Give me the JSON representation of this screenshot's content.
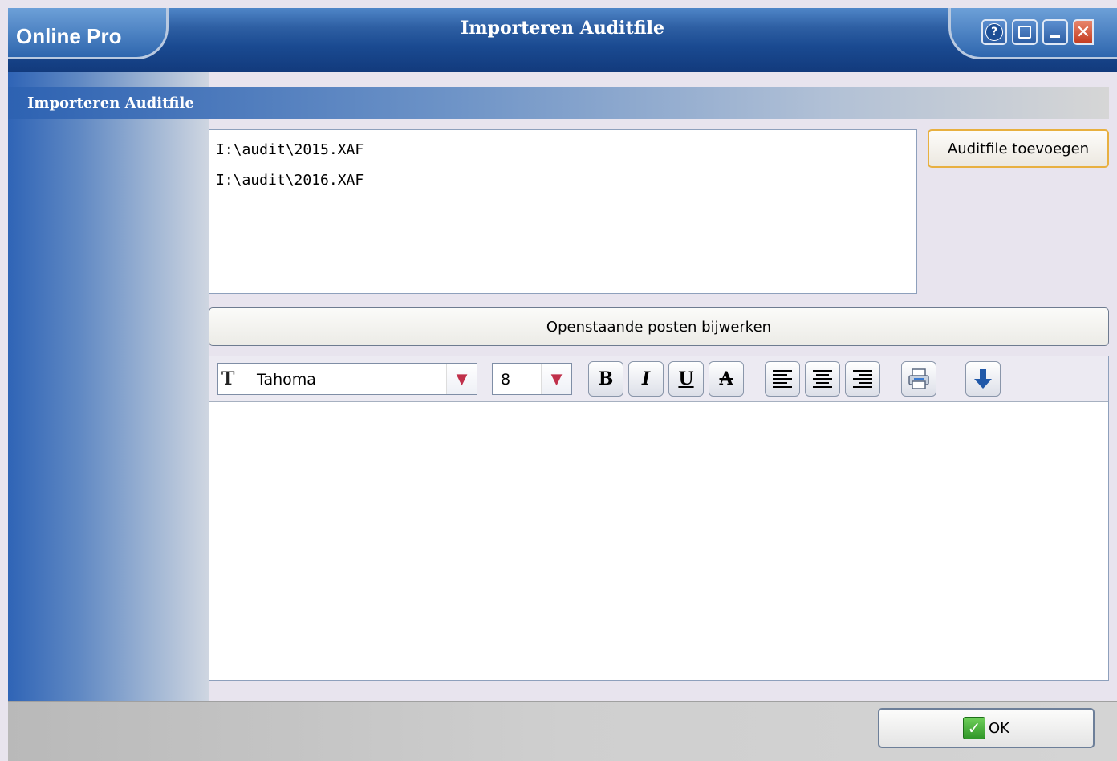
{
  "window": {
    "app_name": "Online Pro",
    "title": "Importeren Auditfile",
    "help_glyph": "?",
    "close_glyph": "✕"
  },
  "section": {
    "title": "Importeren Auditfile"
  },
  "files": [
    "I:\\audit\\2015.XAF",
    "I:\\audit\\2016.XAF"
  ],
  "buttons": {
    "add_auditfile": "Auditfile toevoegen",
    "update_open_items": "Openstaande posten bijwerken",
    "ok": "OK"
  },
  "editor": {
    "font": "Tahoma",
    "size": "8",
    "bold": "B",
    "italic": "I",
    "underline": "U",
    "strike": "A",
    "content": ""
  },
  "icons": [
    "help-icon",
    "screenshot-icon",
    "minimize-icon",
    "close-icon",
    "font-type-icon",
    "print-icon",
    "arrow-down-icon",
    "checkmark-icon"
  ],
  "colors": {
    "titlebar": "#1a4a91",
    "ok_check": "#2f9628",
    "add_button_border": "#e8b040"
  }
}
